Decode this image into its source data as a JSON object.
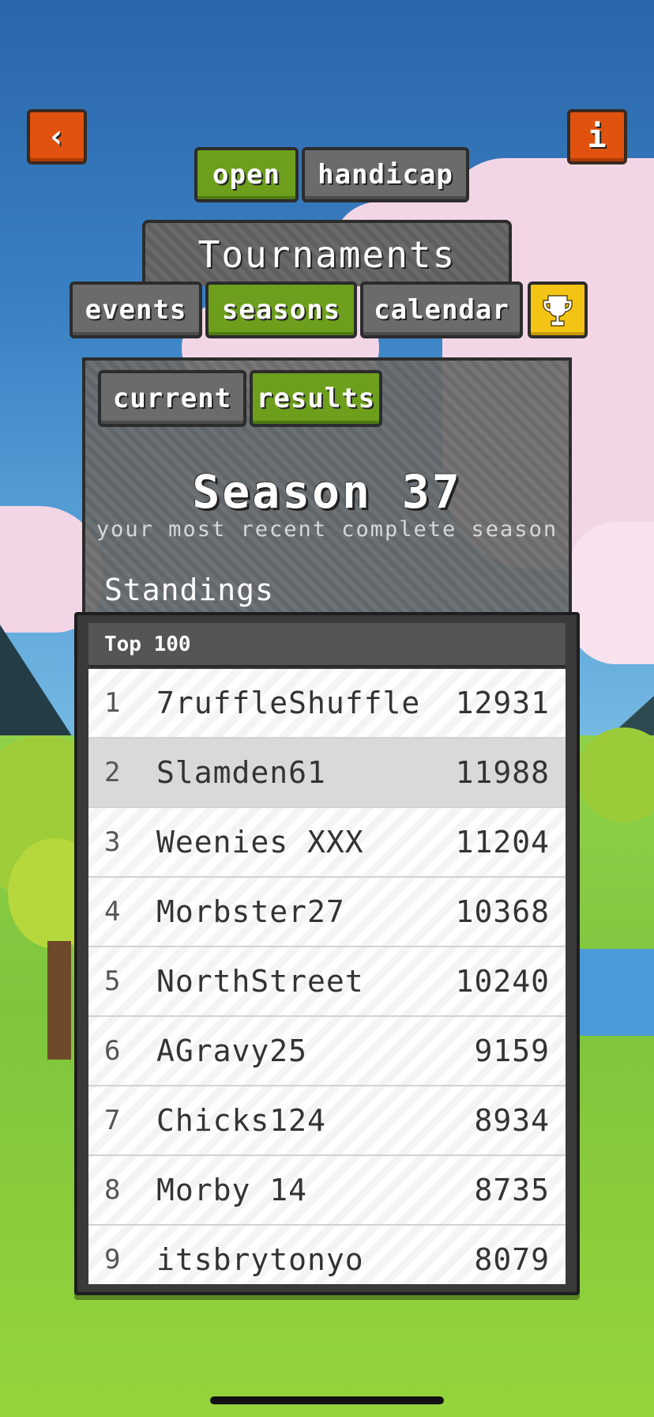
{
  "nav": {
    "back_icon": "chevron-left-icon",
    "info_icon": "info-icon",
    "back_glyph": "‹",
    "info_glyph": "i"
  },
  "mode_tabs": [
    {
      "label": "open",
      "active": true
    },
    {
      "label": "handicap",
      "active": false
    }
  ],
  "title": "Tournaments",
  "section_tabs": [
    {
      "label": "events",
      "active": false
    },
    {
      "label": "seasons",
      "active": true
    },
    {
      "label": "calendar",
      "active": false
    }
  ],
  "trophy_icon": "trophy-icon",
  "sub_tabs": [
    {
      "label": "current",
      "active": false
    },
    {
      "label": "results",
      "active": true
    }
  ],
  "season": {
    "title": "Season 37",
    "subtitle": "your most recent complete season"
  },
  "standings_label": "Standings",
  "leaderboard": {
    "header": "Top 100",
    "rows": [
      {
        "rank": "1",
        "name": "7ruffleShuffle",
        "score": "12931"
      },
      {
        "rank": "2",
        "name": "Slamden61",
        "score": "11988",
        "highlight": true
      },
      {
        "rank": "3",
        "name": "Weenies XXX",
        "score": "11204"
      },
      {
        "rank": "4",
        "name": "Morbster27",
        "score": "10368"
      },
      {
        "rank": "5",
        "name": "NorthStreet",
        "score": "10240"
      },
      {
        "rank": "6",
        "name": "AGravy25",
        "score": "9159"
      },
      {
        "rank": "7",
        "name": "Chicks124",
        "score": "8934"
      },
      {
        "rank": "8",
        "name": "Morby 14",
        "score": "8735"
      },
      {
        "rank": "9",
        "name": "itsbrytonyo",
        "score": "8079"
      }
    ]
  },
  "colors": {
    "active_tab": "#6d9f1c",
    "inactive_tab": "#6b6b6b",
    "nav_button": "#e0520e",
    "trophy_button": "#f3c414"
  }
}
